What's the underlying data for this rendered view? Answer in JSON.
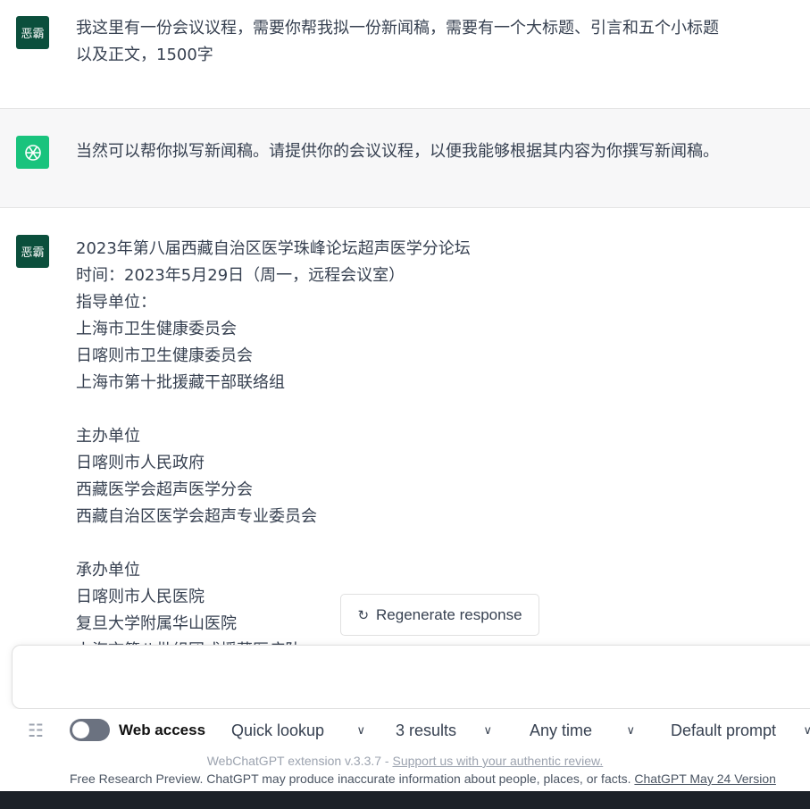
{
  "messages": [
    {
      "role": "user",
      "avatar_text": "恶霸",
      "text": "我这里有一份会议议程，需要你帮我拟一份新闻稿，需要有一个大标题、引言和五个小标题\n以及正文，1500字"
    },
    {
      "role": "assistant",
      "avatar_icon": "openai-logo-icon",
      "text": "当然可以帮你拟写新闻稿。请提供你的会议议程，以便我能够根据其内容为你撰写新闻稿。"
    },
    {
      "role": "user",
      "avatar_text": "恶霸",
      "text": "2023年第八届西藏自治区医学珠峰论坛超声医学分论坛\n时间：2023年5月29日（周一，远程会议室）\n指导单位：\n上海市卫生健康委员会\n日喀则市卫生健康委员会\n上海市第十批援藏干部联络组\n\n主办单位\n日喀则市人民政府\n西藏医学会超声医学分会\n西藏自治区医学会超声专业委员会\n\n承办单位\n日喀则市人民医院\n复旦大学附属华山医院\n上海市第八批组团式援藏医疗队"
    }
  ],
  "regenerate_label": "Regenerate response",
  "toolbar": {
    "web_access_label": "Web access",
    "web_access_on": false,
    "mode": "Quick lookup",
    "results": "3 results",
    "time": "Any time",
    "prompt": "Default prompt"
  },
  "footer": {
    "ext_text": "WebChatGPT extension v.3.3.7 - ",
    "ext_link": "Support us with your authentic review.",
    "disclaimer": "Free Research Preview. ChatGPT may produce inaccurate information about people, places, or facts. ",
    "version_link": "ChatGPT May 24 Version"
  },
  "colors": {
    "user_avatar": "#0b4f3c",
    "assistant_avatar": "#19c37d"
  }
}
